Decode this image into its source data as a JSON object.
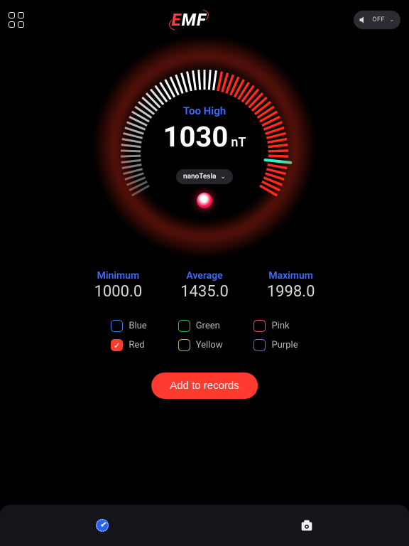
{
  "topbar": {
    "logo_text": "EMF",
    "sound_label": "OFF"
  },
  "gauge": {
    "status": "Too High",
    "value": "1030",
    "unit": "nT",
    "unit_select": "nanoTesla",
    "needle_fraction": 0.9
  },
  "stats": {
    "min_label": "Minimum",
    "min_value": "1000.0",
    "avg_label": "Average",
    "avg_value": "1435.0",
    "max_label": "Maximum",
    "max_value": "1998.0"
  },
  "colors": {
    "blue": {
      "label": "Blue",
      "checked": false
    },
    "red": {
      "label": "Red",
      "checked": true
    },
    "green": {
      "label": "Green",
      "checked": false
    },
    "yellow": {
      "label": "Yellow",
      "checked": false
    },
    "pink": {
      "label": "Pink",
      "checked": false
    },
    "purple": {
      "label": "Purple",
      "checked": false
    }
  },
  "actions": {
    "add_records": "Add to records"
  }
}
